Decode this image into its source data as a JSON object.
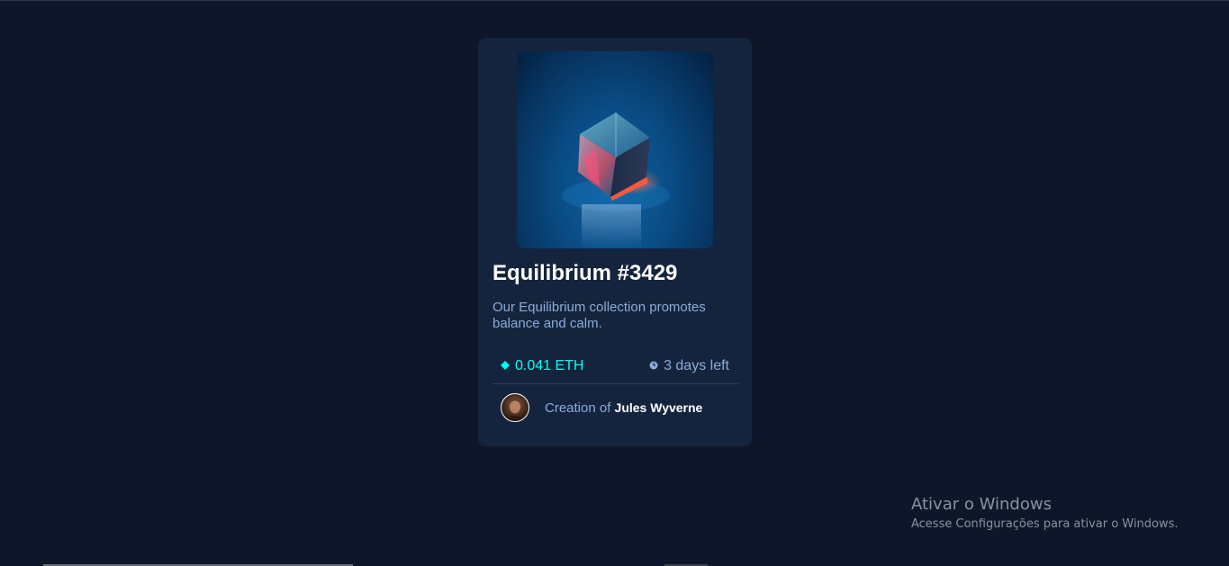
{
  "card": {
    "image": {
      "icon": "crystal-cube-image"
    },
    "title": "Equilibrium #3429",
    "description": "Our Equilibrium collection promotes balance and calm.",
    "price": {
      "icon": "ethereum-icon",
      "value": "0.041 ETH",
      "color": "#00fff8"
    },
    "time": {
      "icon": "clock-icon",
      "value": "3 days left"
    },
    "creator": {
      "prefix": "Creation of",
      "name": "Jules Wyverne"
    }
  },
  "windows_watermark": {
    "title": "Ativar o Windows",
    "subtitle": "Acesse Configurações para ativar o Windows."
  },
  "colors": {
    "background": "#0d1729",
    "card": "#15243d",
    "cyan": "#00fff8",
    "soft_blue": "#8bacd9",
    "white": "#ffffff"
  }
}
